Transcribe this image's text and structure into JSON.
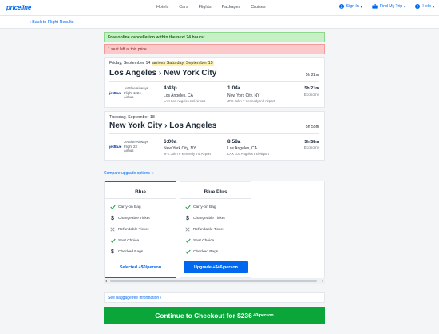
{
  "header": {
    "logo": "priceline",
    "nav": [
      "Hotels",
      "Cars",
      "Flights",
      "Packages",
      "Cruises"
    ],
    "sign_in": "Sign In",
    "find_trip": "Find My Trip",
    "help": "Help"
  },
  "back_link": "‹ Back to Flight Results",
  "banners": {
    "cancellation": "Free online cancellation within the next 24 hours!",
    "seats_left": "1 seat left at this price"
  },
  "outbound": {
    "date": "Friday, September 14",
    "arrival_note": "arrives Saturday, September 15",
    "route": "Los Angeles › New York City",
    "total_duration": "5h 21m",
    "airline": "JetBlue Airways",
    "flight": "Flight 1224",
    "aircraft": "Airbus",
    "airline_logo": "jetBlue",
    "depart_time": "4:43p",
    "depart_city": "Los Angeles, CA",
    "depart_airport": "LAX Los Angeles Intl Airport",
    "arrive_time": "1:04a",
    "arrive_city": "New York City, NY",
    "arrive_airport": "JFK John F Kennedy Intl Airport",
    "duration": "5h 21m",
    "cabin": "Economy"
  },
  "return": {
    "date": "Tuesday, September 18",
    "route": "New York City › Los Angeles",
    "total_duration": "5h 58m",
    "airline": "JetBlue Airways",
    "flight": "Flight 23",
    "aircraft": "Airbus",
    "airline_logo": "jetBlue",
    "depart_time": "6:00a",
    "depart_city": "New York City, NY",
    "depart_airport": "JFK John F Kennedy Intl Airport",
    "arrive_time": "8:58a",
    "arrive_city": "Los Angeles, CA",
    "arrive_airport": "LAX Los Angeles Intl Airport",
    "duration": "5h 58m",
    "cabin": "Economy"
  },
  "compare_link": "Compare upgrade options",
  "upgrades": [
    {
      "title": "Blue",
      "features": [
        {
          "label": "Carry-on Bag",
          "icon": "check-icon"
        },
        {
          "label": "Changeable Ticket",
          "icon": "dollar-icon"
        },
        {
          "label": "Refundable Ticket",
          "icon": "x-icon"
        },
        {
          "label": "Seat Choice",
          "icon": "check-icon"
        },
        {
          "label": "Checked Bags",
          "icon": "dollar-icon"
        }
      ],
      "action": "Selected +$0/person"
    },
    {
      "title": "Blue Plus",
      "features": [
        {
          "label": "Carry-on Bag",
          "icon": "check-icon"
        },
        {
          "label": "Changeable Ticket",
          "icon": "dollar-icon"
        },
        {
          "label": "Refundable Ticket",
          "icon": "x-icon"
        },
        {
          "label": "Seat Choice",
          "icon": "check-icon"
        },
        {
          "label": "Checked Bags",
          "icon": "check-icon"
        }
      ],
      "action": "Upgrade +$46/person"
    }
  ],
  "bag_fees_link": "See baggage fee information ›",
  "checkout": {
    "label": "Continue to Checkout for $236",
    "cents": ".40/person"
  },
  "colors": {
    "brand": "#0068ef",
    "checkout_green": "#0aa63a",
    "green_banner": "#c7f0c7",
    "red_banner": "#fbc9c9"
  }
}
